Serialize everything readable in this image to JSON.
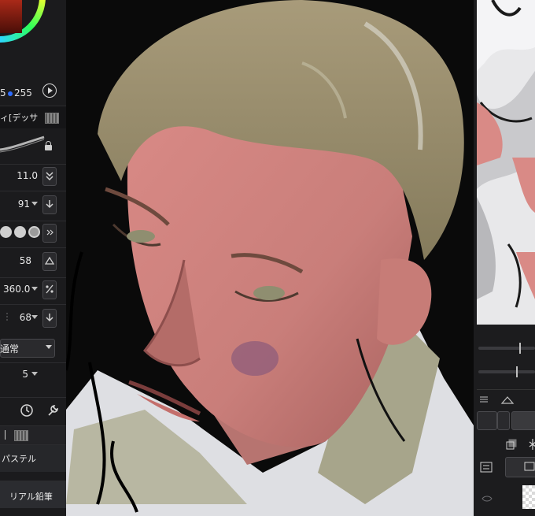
{
  "app": {
    "name": ""
  },
  "color": {
    "rgb_partial": "5",
    "blue_value": "255",
    "wheel_colors": [
      "#ff2d2d",
      "#2d50ff"
    ],
    "current": "#c0301c"
  },
  "brush": {
    "tab_label": "ィ[デッサ",
    "size": "11.0",
    "opacity": "91",
    "density": "58",
    "angle": "360.0",
    "hardness": "68",
    "blend_mode": "通常",
    "stabilizer": "5"
  },
  "brush_list": {
    "items": [
      "パステル",
      "リアル鉛筆"
    ]
  },
  "icons": {
    "play": "play-circle-icon",
    "lock": "lock-icon",
    "stepper_down": "chevron-down-icon",
    "triangle": "triangle-icon",
    "percent": "percent-icon",
    "clock": "clock-icon",
    "wrench": "wrench-icon"
  },
  "accent": {
    "ui_bg": "#1b1b1d",
    "canvas_bg": "#0c0c0c"
  }
}
